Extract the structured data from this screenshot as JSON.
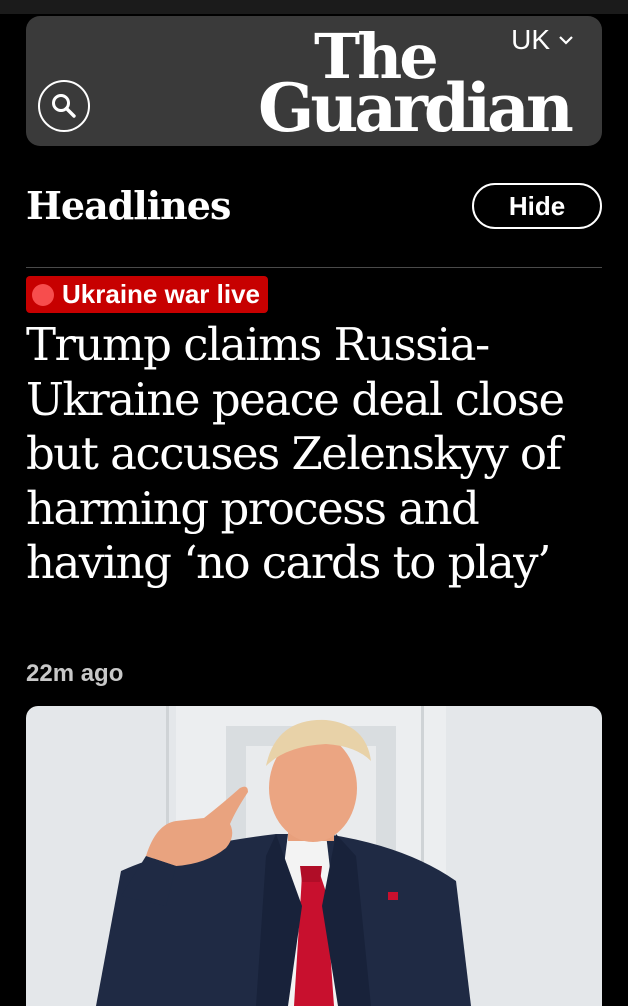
{
  "header": {
    "edition_label": "UK",
    "logo_line1": "The",
    "logo_line2": "Guardian"
  },
  "section": {
    "title": "Headlines",
    "hide_label": "Hide"
  },
  "article": {
    "kicker": "Ukraine war live",
    "headline": "Trump claims Russia-Ukraine peace deal close but accuses Zelenskyy of harming process and having ‘no cards to play’",
    "timestamp": "22m ago"
  },
  "icons": {
    "search": "search-icon",
    "edition_menu": "chevron-down-icon",
    "live": "live-dot-icon"
  },
  "colors": {
    "background": "#000000",
    "header_card": "#3a3a3a",
    "kicker_bg": "#c70000",
    "live_dot": "#ff5a5a",
    "timestamp": "#c8c8c8"
  }
}
